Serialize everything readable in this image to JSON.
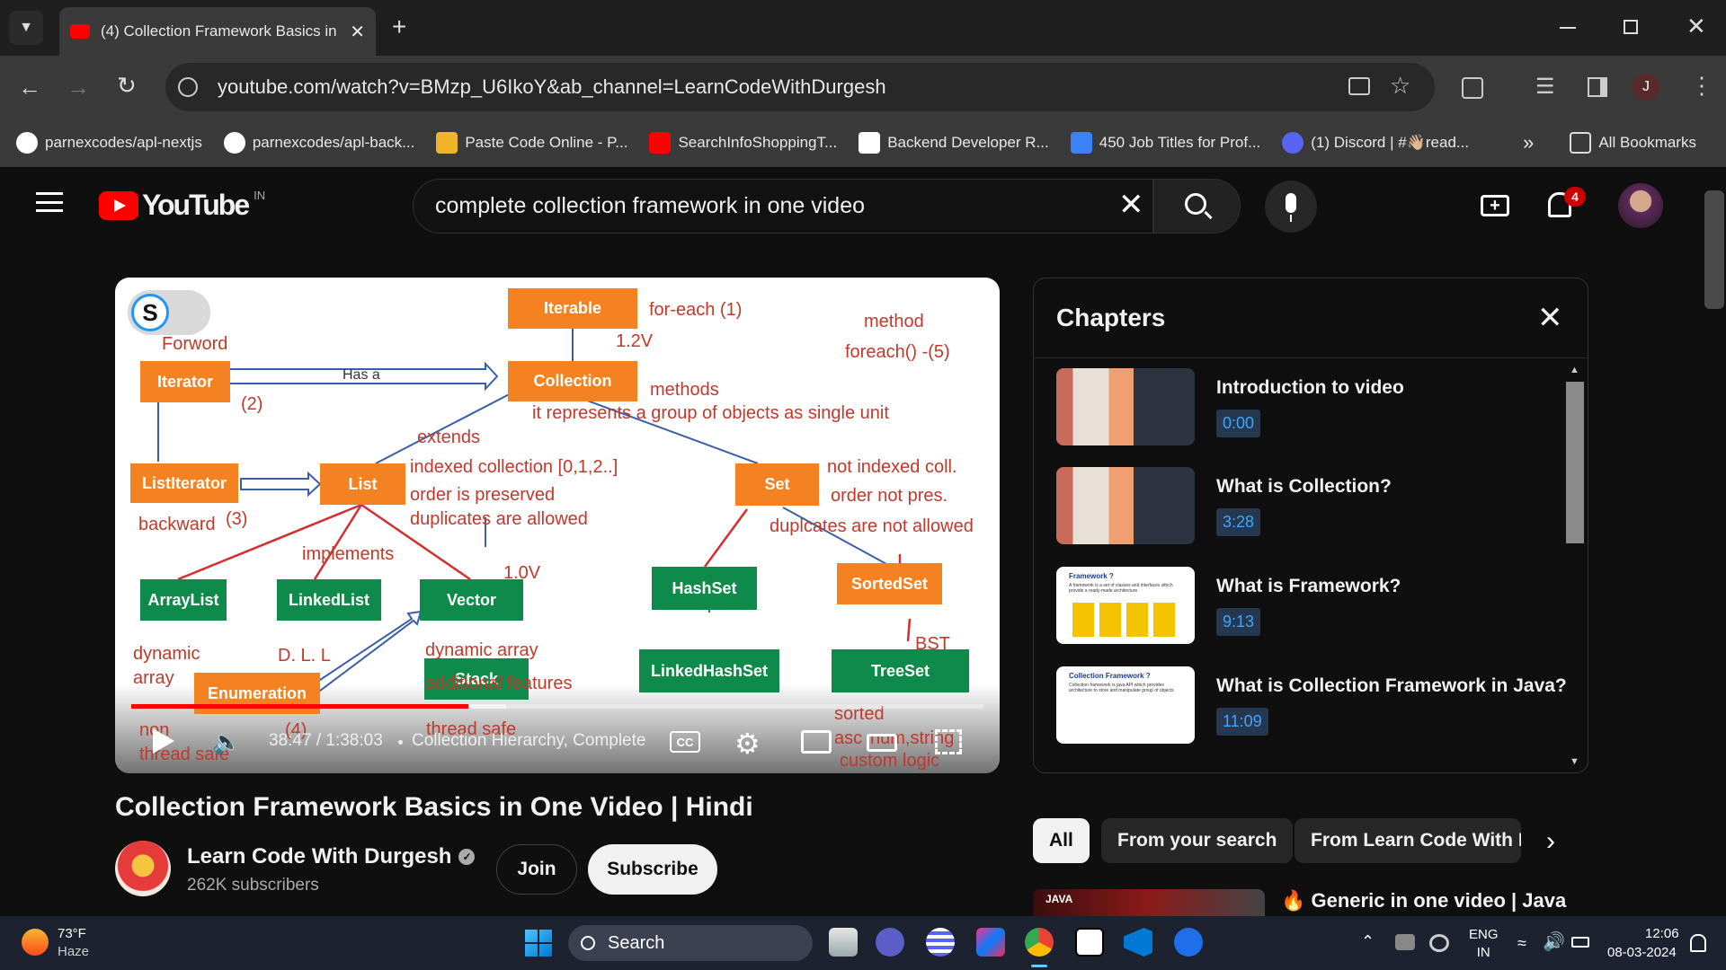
{
  "browser": {
    "tab_title": "(4) Collection Framework Basics in",
    "url": "youtube.com/watch?v=BMzp_U6IkoY&ab_channel=LearnCodeWithDurgesh",
    "profile_initial": "J",
    "bookmarks": [
      "parnexcodes/apl-nextjs",
      "parnexcodes/apl-back...",
      "Paste Code Online - P...",
      "SearchInfoShoppingT...",
      "Backend Developer R...",
      "450 Job Titles for Prof...",
      "(1) Discord | #👋🏼read..."
    ],
    "all_bookmarks": "All Bookmarks"
  },
  "youtube": {
    "logo": "YouTube",
    "region": "IN",
    "search_value": "complete collection framework in one video",
    "notif_count": "4"
  },
  "video": {
    "title": "Collection Framework Basics in One Video | Hindi",
    "time": "38:47 / 1:38:03",
    "chapter": "Collection Hierarchy, Complete",
    "progress": 0.396,
    "channel": "Learn Code With Durgesh",
    "subscribers": "262K subscribers",
    "join": "Join",
    "subscribe": "Subscribe",
    "badge": "S"
  },
  "diagram": {
    "nodes": {
      "iterable": "Iterable",
      "collection": "Collection",
      "iterator": "Iterator",
      "listiterator": "ListIterator",
      "list": "List",
      "set": "Set",
      "arraylist": "ArrayList",
      "linkedlist": "LinkedList",
      "vector": "Vector",
      "hashset": "HashSet",
      "sortedset": "SortedSet",
      "linkedhashset": "LinkedHashSet",
      "treeset": "TreeSet",
      "enumeration": "Enumeration",
      "stack": "Stack"
    },
    "notes": {
      "foreach": "for-each  (1)",
      "v12": "1.2V",
      "method": "method",
      "foreach5": "foreach() -(5)",
      "forword": "Forword",
      "hasa": "Has a",
      "n2": "(2)",
      "methods": "methods",
      "represents": "it represents a group of objects as single unit",
      "extends": "extends",
      "indexed": "indexed collection [0,1,2..]",
      "order": "order is preserved",
      "dups": "duplicates are allowed",
      "notindexed": "not indexed coll.",
      "ordernot": "order not pres.",
      "dupsnot": "duplcates are not allowed",
      "backward": "backward",
      "n3": "(3)",
      "implements": "implements",
      "v10": "1.0V",
      "dynamic": "dynamic",
      "array": "array",
      "dll": "D. L. L",
      "dynarray": "dynamic array",
      "additional": "additional features",
      "bst": "BST",
      "sorted": "sorted",
      "asc": "asc",
      "num": "num,string",
      "custom": "custom logic",
      "non": "non",
      "threadsafe": "thread safe",
      "n4": "(4)",
      "threadsafe2": "thread safe"
    }
  },
  "chapters": {
    "heading": "Chapters",
    "items": [
      {
        "title": "Introduction to video",
        "time": "0:00"
      },
      {
        "title": "What is Collection?",
        "time": "3:28"
      },
      {
        "title": "What is Framework?",
        "time": "9:13"
      },
      {
        "title": "What is Collection Framework in Java?",
        "time": "11:09"
      }
    ],
    "thumb3": {
      "heading": "Framework ?",
      "text": "A framework is a set of classes and interfaces which provide a ready-made architecture."
    },
    "thumb4": {
      "heading": "Collection Framework ?",
      "text": "Collection framework is java API which provides architecture to store and manipulate group of objects"
    }
  },
  "filters": [
    "All",
    "From your search",
    "From Learn Code With D"
  ],
  "next_video": {
    "title": "🔥 Generic in one video | Java",
    "thumb_label": "JAVA"
  },
  "taskbar": {
    "temp": "73°F",
    "weather": "Haze",
    "search": "Search",
    "lang1": "ENG",
    "lang2": "IN",
    "time": "12:06",
    "date": "08-03-2024"
  }
}
